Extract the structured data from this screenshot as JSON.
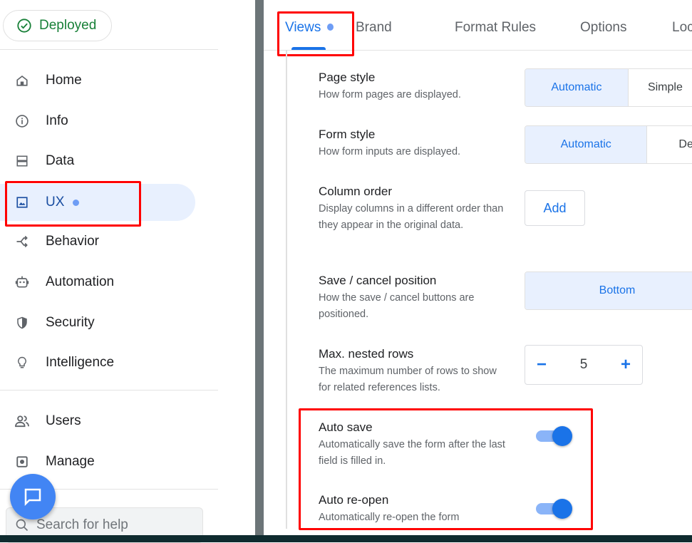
{
  "sidebar": {
    "status": "Deployed",
    "items": [
      {
        "label": "Home",
        "icon": "home-icon"
      },
      {
        "label": "Info",
        "icon": "info-icon"
      },
      {
        "label": "Data",
        "icon": "data-icon"
      },
      {
        "label": "UX",
        "icon": "image-icon",
        "active": true
      },
      {
        "label": "Behavior",
        "icon": "behavior-icon"
      },
      {
        "label": "Automation",
        "icon": "robot-icon"
      },
      {
        "label": "Security",
        "icon": "shield-icon"
      },
      {
        "label": "Intelligence",
        "icon": "lightbulb-icon"
      },
      {
        "label": "Users",
        "icon": "users-icon"
      },
      {
        "label": "Manage",
        "icon": "manage-icon"
      }
    ],
    "search_placeholder": "Search for help"
  },
  "tabs": [
    "Views",
    "Brand",
    "Format Rules",
    "Options",
    "Loc"
  ],
  "settings": {
    "page_style": {
      "title": "Page style",
      "desc": "How form pages are displayed.",
      "options": [
        "Automatic",
        "Simple"
      ],
      "selected": "Automatic"
    },
    "form_style": {
      "title": "Form style",
      "desc": "How form inputs are displayed.",
      "options": [
        "Automatic",
        "De"
      ],
      "selected": "Automatic"
    },
    "column_order": {
      "title": "Column order",
      "desc": "Display columns in a different order than they appear in the original data.",
      "button": "Add"
    },
    "save_cancel": {
      "title": "Save / cancel position",
      "desc": "How the save / cancel buttons are positioned.",
      "options": [
        "Bottom"
      ],
      "selected": "Bottom"
    },
    "max_nested": {
      "title": "Max. nested rows",
      "desc": "The maximum number of rows to show for related references lists.",
      "value": "5",
      "minus": "−",
      "plus": "+"
    },
    "auto_save": {
      "title": "Auto save",
      "desc": "Automatically save the form after the last field is filled in.",
      "on": true
    },
    "auto_reopen": {
      "title": "Auto re-open",
      "desc": "Automatically re-open the form",
      "on": true
    }
  },
  "colors": {
    "accent": "#1a73e8",
    "deployed": "#188038",
    "highlight": "#ff0000"
  }
}
